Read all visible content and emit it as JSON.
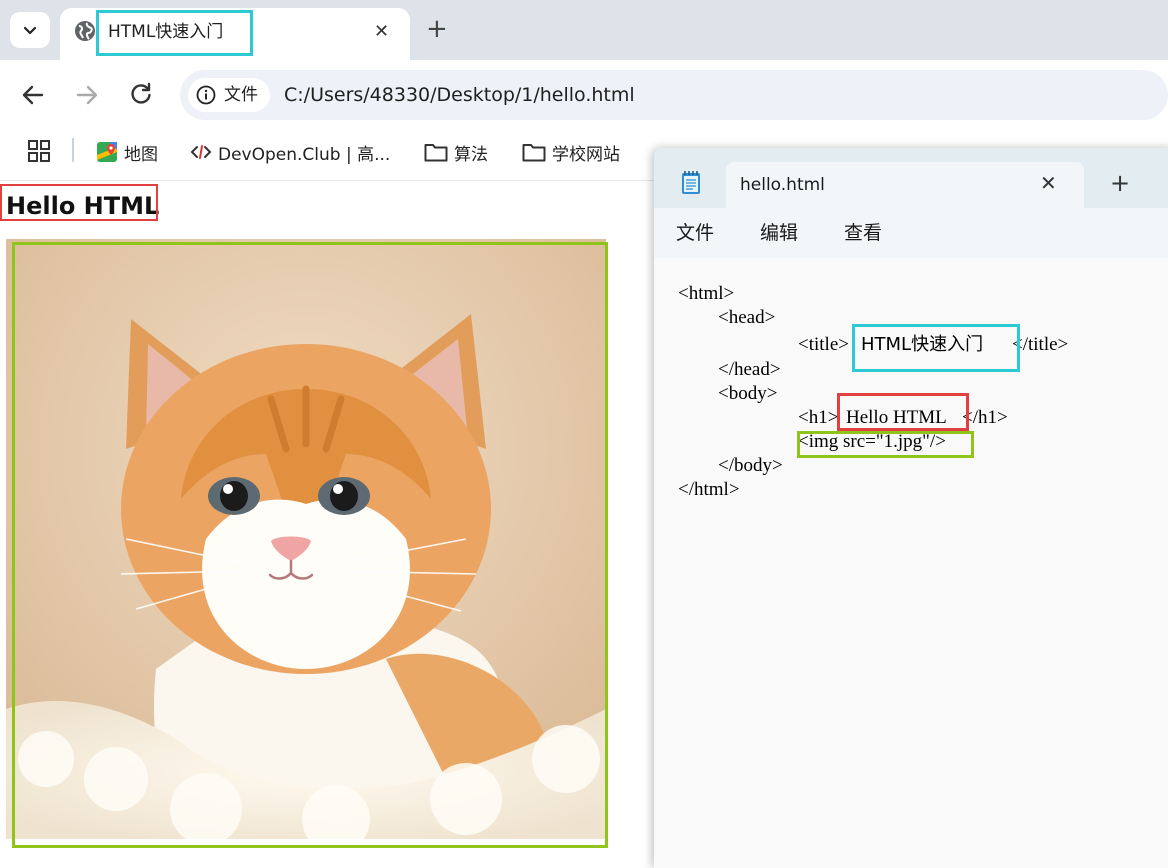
{
  "browser": {
    "tab_title": "HTML快速入门",
    "new_tab_symbol": "+",
    "close_symbol": "✕",
    "site_chip": "文件",
    "url": "C:/Users/48330/Desktop/1/hello.html",
    "bookmarks": [
      {
        "icon": "maps-icon",
        "label": "地图"
      },
      {
        "icon": "code-icon",
        "label": "DevOpen.Club | 高..."
      },
      {
        "icon": "folder-icon",
        "label": "算法"
      },
      {
        "icon": "folder-icon",
        "label": "学校网站"
      }
    ]
  },
  "page": {
    "h1": "Hello HTML",
    "image": "kitten-photo"
  },
  "notepad": {
    "tab_title": "hello.html",
    "new_tab_symbol": "+",
    "close_symbol": "✕",
    "menu": [
      "文件",
      "编辑",
      "查看"
    ],
    "code": {
      "l1": "<html>",
      "l2": "<head>",
      "l3a": "<title>",
      "l3b": "HTML快速入门",
      "l3c": "</title>",
      "l4": "</head>",
      "l5": "<body>",
      "l6a": "<h1>",
      "l6b": "Hello HTML",
      "l6c": "</h1>",
      "l7": "<img src=\"1.jpg\"/>",
      "l8": "</body>",
      "l9": "</html>"
    }
  },
  "colors": {
    "highlight_red": "#e04040",
    "highlight_cyan": "#2dcad4",
    "highlight_green": "#8fc41a"
  }
}
